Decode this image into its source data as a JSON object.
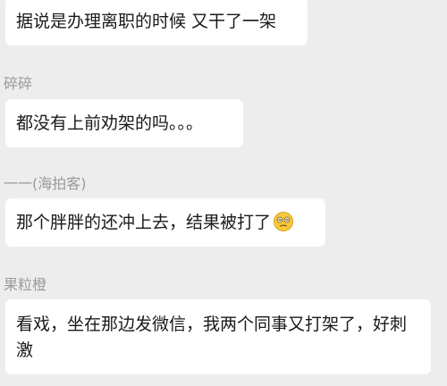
{
  "messages": [
    {
      "sender": "",
      "text": "据说是办理离职的时候 又干了一架"
    },
    {
      "sender": "碎碎",
      "text": "都没有上前劝架的吗。。。"
    },
    {
      "sender": "一一(海拍客)",
      "text": "那个胖胖的还冲上去，结果被打了",
      "emoji": "dizzy-face-emoji"
    },
    {
      "sender": "果粒橙",
      "text": "看戏，坐在那边发微信，我两个同事又打架了，好刺激"
    }
  ]
}
